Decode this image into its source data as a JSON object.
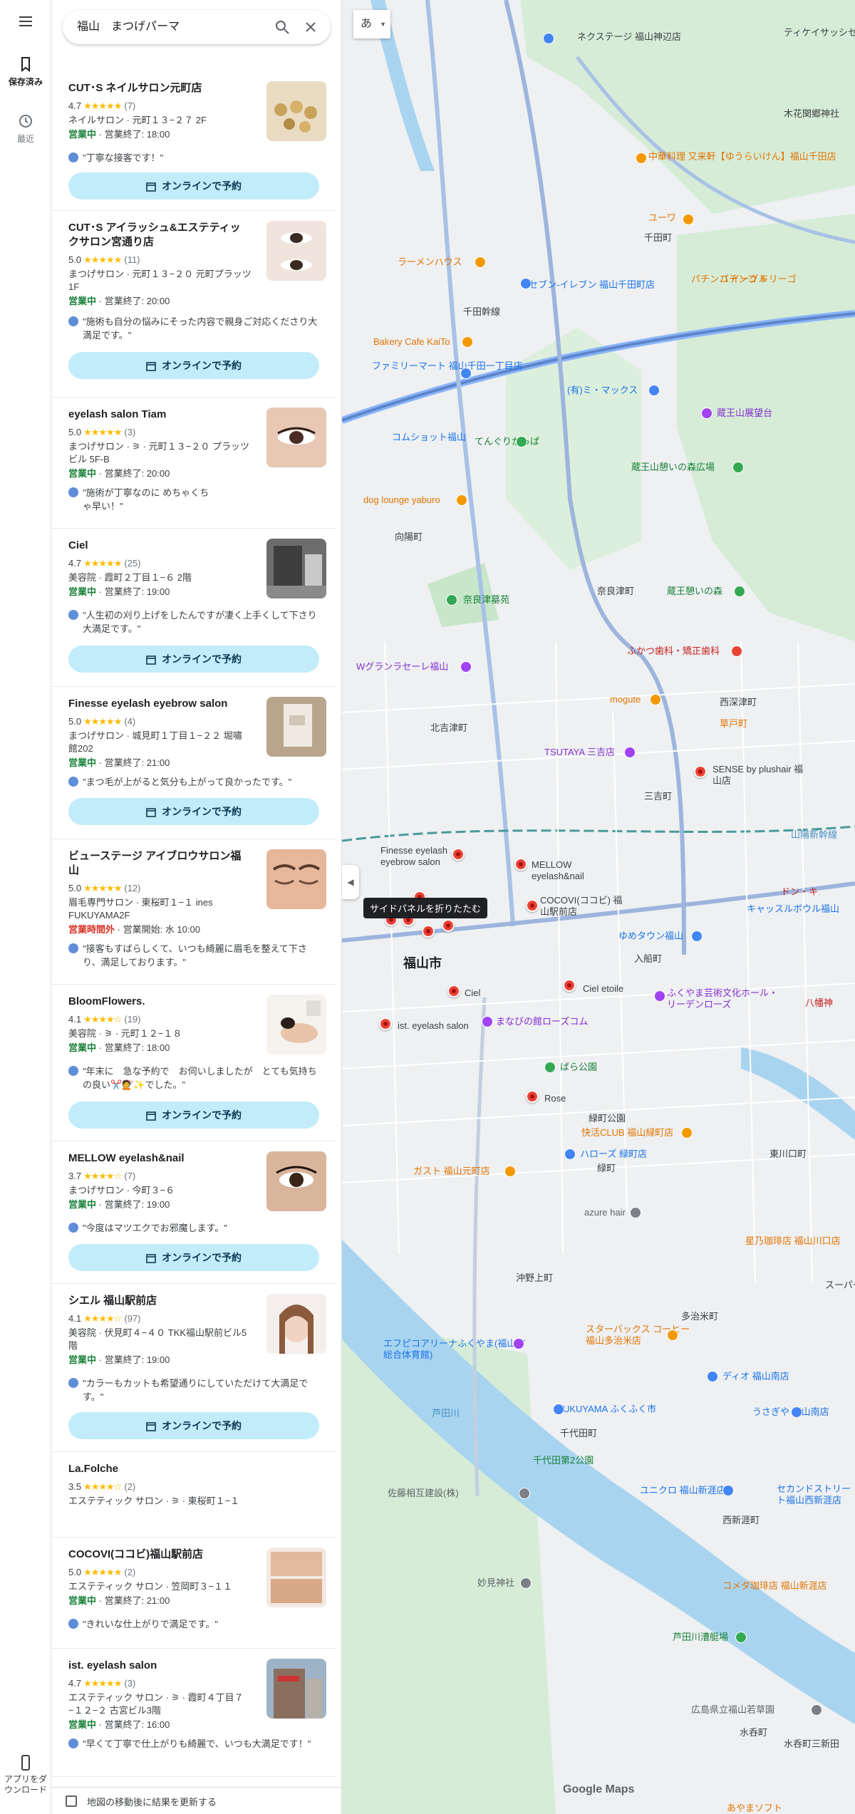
{
  "rail": {
    "menu_icon": "hamburger-menu-icon",
    "saved_label": "保存済み",
    "recent_label": "最近",
    "app_label_1": "アプリをダ",
    "app_label_2": "ウンロード"
  },
  "search": {
    "query": "福山　まつげパーマ"
  },
  "results": [
    {
      "name": "CUT･S ネイルサロン元町店",
      "rating": "4.7",
      "stars": "★★★★★",
      "count": "(7)",
      "category": "ネイルサロン · 元町１３−２７ 2F",
      "status": "営業中",
      "status_detail": " · 営業終了: 18:00",
      "review": "\"丁寧な接客です！\"",
      "button": "オンラインで予約"
    },
    {
      "name": "CUT･S アイラッシュ&エステティックサロン宮通り店",
      "rating": "5.0",
      "stars": "★★★★★",
      "count": "(11)",
      "category": "まつげサロン · 元町１３−２０ 元町プラッツ 1F",
      "status": "営業中",
      "status_detail": " · 営業終了: 20:00",
      "review": "\"施術も自分の悩みにそった内容で親身ご対応くださり大満足です。\"",
      "button": "オンラインで予約"
    },
    {
      "name": "eyelash salon Tiam",
      "rating": "5.0",
      "stars": "★★★★★",
      "count": "(3)",
      "category": "まつげサロン · ⚞ · 元町１３−２０ プラッツビル 5F-B",
      "status": "営業中",
      "status_detail": " · 営業終了: 20:00",
      "review": "\"施術が丁寧なのに めちゃくちゃ早い！\""
    },
    {
      "name": "Ciel",
      "rating": "4.7",
      "stars": "★★★★★",
      "count": "(25)",
      "category": "美容院 · 霞町２丁目１−６ 2階",
      "status": "営業中",
      "status_detail": " · 営業終了: 19:00",
      "review": "\"人生初の刈り上げをしたんですが凄く上手くして下さり大満足です。\"",
      "button": "オンラインで予約"
    },
    {
      "name": "Finesse eyelash eyebrow salon",
      "rating": "5.0",
      "stars": "★★★★★",
      "count": "(4)",
      "category": "まつげサロン · 城見町１丁目１−２２ 堀嘯 館202",
      "status": "営業中",
      "status_detail": " · 営業終了: 21:00",
      "review": "\"まつ毛が上がると気分も上がって良かったです。\"",
      "button": "オンラインで予約"
    },
    {
      "name": "ビューステージ アイブロウサロン福山",
      "rating": "5.0",
      "stars": "★★★★★",
      "count": "(12)",
      "category": "眉毛専門サロン · 東桜町１−１ ines FUKUYAMA2F",
      "status": "営業時間外",
      "status_detail": " · 営業開始: 水 10:00",
      "review": "\"接客もすばらしくて、いつも綺麗に眉毛を整えて下さり、満足しております。\""
    },
    {
      "name": "BloomFlowers.",
      "rating": "4.1",
      "stars": "★★★★☆",
      "count": "(19)",
      "category": "美容院 · ⚞ · 元町１２−１８",
      "status": "営業中",
      "status_detail": " · 営業終了: 18:00",
      "review": "\"年末に　急な予約で　お伺いしましたが　とても気持ちの良い✂️💇✨でした。\"",
      "button": "オンラインで予約"
    },
    {
      "name": "MELLOW eyelash&nail",
      "rating": "3.7",
      "stars": "★★★★☆",
      "count": "(7)",
      "category": "まつげサロン · 今町３−６",
      "status": "営業中",
      "status_detail": " · 営業終了: 19:00",
      "review": "\"今度はマツエクでお邪魔します。\"",
      "button": "オンラインで予約"
    },
    {
      "name": "シエル 福山駅前店",
      "rating": "4.1",
      "stars": "★★★★☆",
      "count": "(97)",
      "category": "美容院 · 伏見町４−４０ TKK福山駅前ビル5階",
      "status": "営業中",
      "status_detail": " · 営業終了: 19:00",
      "review": "\"カラーもカットも希望通りにしていただけて大満足です。\"",
      "button": "オンラインで予約"
    },
    {
      "name": "La.Folche",
      "rating": "3.5",
      "stars": "★★★★☆",
      "count": "(2)",
      "category": "エステティック サロン · ⚞ · 東桜町１−１"
    },
    {
      "name": "COCOVI(ココビ)福山駅前店",
      "rating": "5.0",
      "stars": "★★★★★",
      "count": "(2)",
      "category": "エステティック サロン · 笠岡町３−１１",
      "status": "営業中",
      "status_detail": " · 営業終了: 21:00",
      "review": "\"きれいな仕上がりで満足です。\""
    },
    {
      "name": "ist. eyelash salon",
      "rating": "4.7",
      "stars": "★★★★★",
      "count": "(3)",
      "category": "エステティック サロン · ⚞ · 霞町４丁目７−１２−２ 古宮ビル3階",
      "status": "営業中",
      "status_detail": " · 営業終了: 16:00",
      "review": "\"早くて丁寧で仕上がりも綺麗で、いつも大満足です！\""
    }
  ],
  "footer": {
    "update_label": "地図の移動後に結果を更新する"
  },
  "map": {
    "lang_button": "あ",
    "collapse_tooltip": "サイドパネルを折りたたむ",
    "city_label": "福山市",
    "attribution": "Google Maps",
    "labels": [
      "ネクステージ 福山神辺店",
      "ティケイサッシセンタ",
      "木花関郷神社",
      "中華料理 又来軒【ゆうらいけん】福山千田店",
      "ユーワ",
      "千田町",
      "パチンコ イーグル",
      "パチンコ ドリーゴ",
      "ラーメンハウス",
      "セブン-イレブン 福山千田町店",
      "千田幹線",
      "Bakery Cafe KaiTo",
      "ファミリーマート 福山千田一丁目店",
      "(有)ミ・マックス",
      "蔵王山展望台",
      "コムショット福山",
      "てんぐりかっぱ",
      "蔵王山憩いの森広場",
      "dog lounge yaburo",
      "蔵王憩いの森",
      "奈良津墓苑",
      "奈良津町",
      "向陽町",
      "ふかつ歯科・矯正歯科",
      "Wグランラセーレ福山",
      "mogute",
      "西深津町",
      "草戸町",
      "北吉津町",
      "TSUTAYA 三吉店",
      "三吉町",
      "SENSE by plushair 福山店",
      "Finesse eyelash eyebrow salon",
      "MELLOW eyelash&nail",
      "COCOVI(ココビ) 福山駅前店",
      "ゆめタウン福山",
      "入船町",
      "ふくやま芸術文化ホール・リーデンローズ",
      "Ciel",
      "Ciel etoile",
      "ist. eyelash salon",
      "まなびの館ローズコム",
      "八幡神",
      "ばら公園",
      "Rose",
      "緑町公園",
      "快活CLUB 福山緑町店",
      "ハローズ 緑町店",
      "緑町",
      "ガスト 福山元町店",
      "東川口町",
      "azure hair",
      "星乃珈琲店 福山川口店",
      "スーパー銭",
      "沖野上町",
      "スターバックス コーヒー 福山多治米店",
      "多治米町",
      "エフピコアリーナふくやま(福山市総合体育館)",
      "ディオ 福山南店",
      "FUKUYAMA ふくふく市",
      "千代田町",
      "うさぎや 福山南店",
      "芦田川",
      "千代田第2公園",
      "ユニクロ 福山新涯店",
      "佐藤相互建設(株)",
      "セカンドストリート福山西新涯店",
      "西新涯町",
      "妙見神社",
      "コメダ珈琲店 福山新涯店",
      "芦田川漕艇場",
      "広島県立福山若草園",
      "水呑町",
      "水呑町三新田",
      "あやまソフト",
      "キャッスルボウル福山",
      "ドン・キ",
      "山陽新幹線"
    ]
  }
}
